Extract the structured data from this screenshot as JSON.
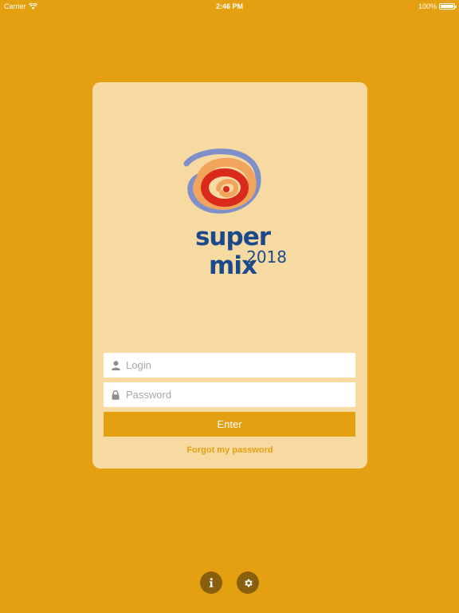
{
  "status_bar": {
    "carrier": "Carrier",
    "time": "2:46 PM",
    "battery_percent": "100%",
    "battery_level": 1.0
  },
  "logo": {
    "title": "super mix",
    "year": "2018"
  },
  "login_form": {
    "login_placeholder": "Login",
    "password_placeholder": "Password",
    "login_icon": "user-icon",
    "password_icon": "lock-icon",
    "enter_label": "Enter",
    "forgot_label": "Forgot my password"
  },
  "footer": {
    "info_icon": "info-icon",
    "settings_icon": "gear-icon"
  },
  "colors": {
    "background": "#E5A012",
    "card": "#F7DAA2",
    "logo_text": "#1A4A8C",
    "button": "#E5A012",
    "footer_button": "#8A5F0C"
  }
}
